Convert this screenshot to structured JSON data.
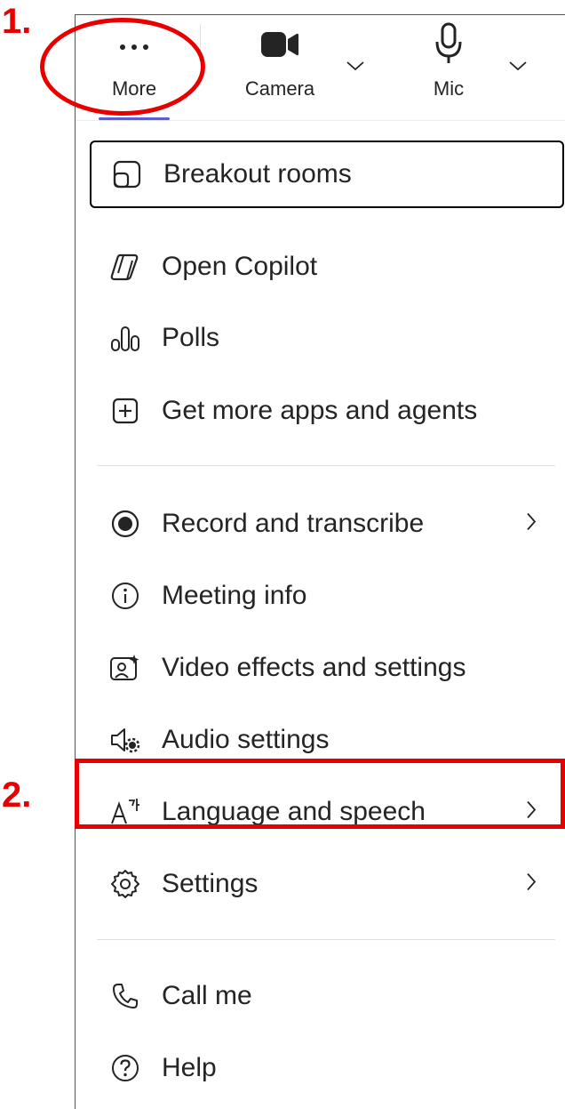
{
  "toolbar": {
    "more_label": "More",
    "camera_label": "Camera",
    "mic_label": "Mic"
  },
  "menu": {
    "breakout_rooms": "Breakout rooms",
    "open_copilot": "Open Copilot",
    "polls": "Polls",
    "get_more_apps": "Get more apps and agents",
    "record_transcribe": "Record and transcribe",
    "meeting_info": "Meeting info",
    "video_effects": "Video effects and settings",
    "audio_settings": "Audio settings",
    "language_speech": "Language and speech",
    "settings": "Settings",
    "call_me": "Call me",
    "help": "Help"
  },
  "annotations": {
    "step1": "1.",
    "step2": "2."
  },
  "colors": {
    "annotation": "#e80000",
    "accent": "#5b5fc7",
    "text": "#242424"
  },
  "icons": [
    "more-icon",
    "camera-icon",
    "mic-icon",
    "chevron-down-icon",
    "breakout-rooms-icon",
    "copilot-icon",
    "polls-icon",
    "add-app-icon",
    "record-icon",
    "info-icon",
    "video-effects-icon",
    "audio-settings-icon",
    "language-icon",
    "gear-icon",
    "phone-icon",
    "help-icon",
    "chevron-right-icon"
  ]
}
